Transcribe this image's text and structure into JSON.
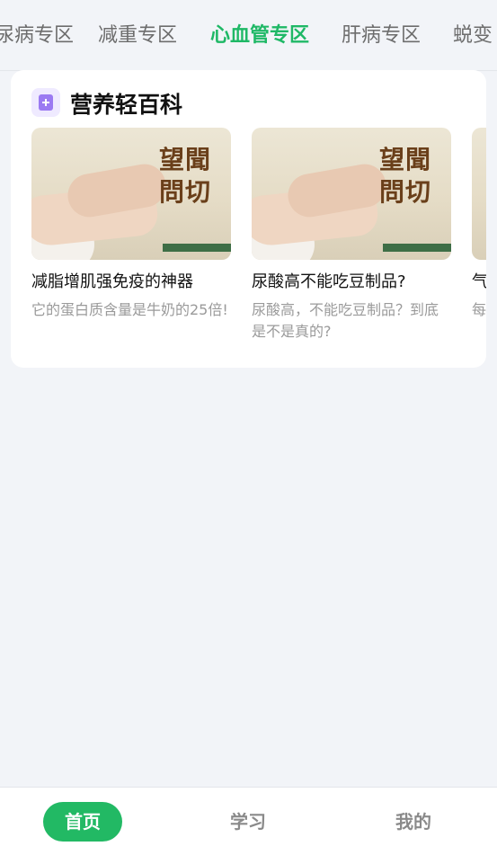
{
  "tabs": [
    {
      "label": "尿病专区",
      "active": false
    },
    {
      "label": "减重专区",
      "active": false
    },
    {
      "label": "心血管专区",
      "active": true
    },
    {
      "label": "肝病专区",
      "active": false
    },
    {
      "label": "蜕变",
      "active": false
    }
  ],
  "section": {
    "icon": "book-plus-icon",
    "title": "营养轻百科"
  },
  "articles": [
    {
      "title": "减脂增肌强免疫的神器",
      "subtitle": "它的蛋白质含量是牛奶的25倍!",
      "thumb_text": "望聞問切"
    },
    {
      "title": "尿酸高不能吃豆制品?",
      "subtitle": "尿酸高，不能吃豆制品？到底是不是真的?",
      "thumb_text": "望聞問切"
    },
    {
      "title": "气",
      "subtitle": "每气",
      "thumb_text": ""
    }
  ],
  "bottom_nav": [
    {
      "label": "首页",
      "active": true
    },
    {
      "label": "学习",
      "active": false
    },
    {
      "label": "我的",
      "active": false
    }
  ],
  "colors": {
    "accent": "#22b964",
    "background": "#f2f4f8",
    "tab_active": "#1fb866"
  }
}
